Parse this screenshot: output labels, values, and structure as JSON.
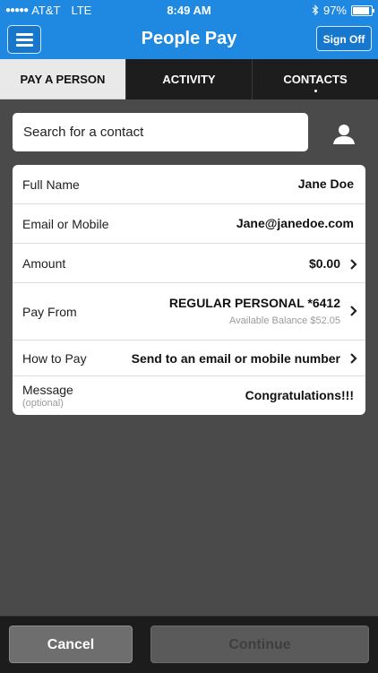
{
  "status_bar": {
    "carrier": "AT&T",
    "network": "LTE",
    "time": "8:49 AM",
    "battery": "97%",
    "battery_level": 0.97,
    "icons": [
      "signal-dots-icon",
      "bluetooth-icon",
      "battery-icon"
    ]
  },
  "header": {
    "title": "People Pay",
    "sign_off_label": "Sign Off",
    "menu_icon": "hamburger-menu-icon"
  },
  "tabs": [
    {
      "label": "PAY A PERSON",
      "active": true
    },
    {
      "label": "ACTIVITY",
      "active": false
    },
    {
      "label": "CONTACTS",
      "active": false
    }
  ],
  "search": {
    "placeholder": "Search for a contact",
    "icon": "contact-person-icon"
  },
  "form": {
    "full_name": {
      "label": "Full Name",
      "value": "Jane Doe"
    },
    "email_or_mobile": {
      "label": "Email or Mobile",
      "value": "Jane@janedoe.com"
    },
    "amount": {
      "label": "Amount",
      "value": "$0.00"
    },
    "pay_from": {
      "label": "Pay From",
      "value": "REGULAR PERSONAL *6412",
      "available_balance": "Available Balance $52.05"
    },
    "how_to_pay": {
      "label": "How to Pay",
      "value": "Send to an email or mobile number"
    },
    "message": {
      "label": "Message",
      "optional": "(optional)",
      "value": "Congratulations!!!"
    }
  },
  "bottom": {
    "cancel_label": "Cancel",
    "continue_label": "Continue"
  },
  "colors": {
    "header_blue": "#1f88e0",
    "background": "#4a4a4a",
    "tab_bar": "#1d1d1d",
    "bottom_bar": "#1c1c1c"
  }
}
